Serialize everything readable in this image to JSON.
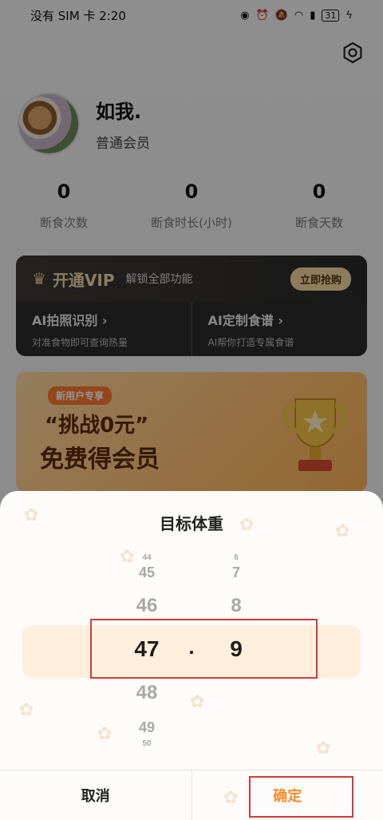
{
  "status_bar": {
    "left_text": "没有 SIM 卡 2:20",
    "battery": "31"
  },
  "icons": [
    "eye-icon",
    "alarm-icon",
    "mute-icon",
    "wifi-icon",
    "sim-alert-icon",
    "battery-icon",
    "charging-icon",
    "settings-icon",
    "crown-icon",
    "chevron-right-icon",
    "paw-icon"
  ],
  "profile": {
    "name": "如我.",
    "level": "普通会员"
  },
  "stats": [
    {
      "value": "0",
      "label": "断食次数"
    },
    {
      "value": "0",
      "label": "断食时长(小时)"
    },
    {
      "value": "0",
      "label": "断食天数"
    }
  ],
  "vip": {
    "title": "开通VIP",
    "subtitle": "解锁全部功能",
    "button": "立即抢购",
    "features": [
      {
        "title": "AI拍照识别",
        "subtitle": "对准食物即可查询热量"
      },
      {
        "title": "AI定制食谱",
        "subtitle": "AI帮你打造专属食谱"
      }
    ]
  },
  "banner": {
    "tag": "新用户专享",
    "line1": "“挑战0元”",
    "line2": "免费得会员"
  },
  "sheet": {
    "title": "目标体重",
    "integer_column": [
      "44",
      "45",
      "46",
      "47",
      "48",
      "49",
      "50"
    ],
    "decimal_column": [
      "6",
      "7",
      "8",
      "9"
    ],
    "selected_integer": "47",
    "separator": ".",
    "selected_decimal": "9",
    "cancel_label": "取消",
    "confirm_label": "确定"
  },
  "colors": {
    "accent": "#ff8a2a",
    "highlight": "#ffefdc",
    "annotation": "#d23a3a"
  }
}
